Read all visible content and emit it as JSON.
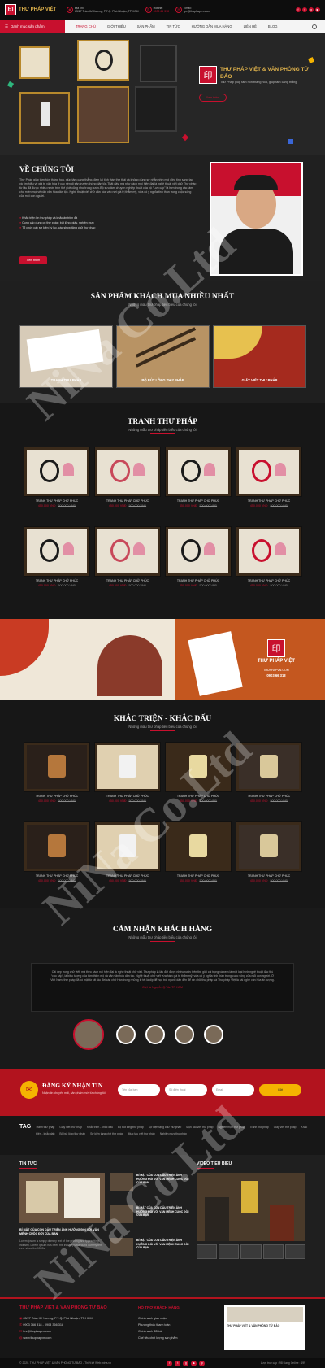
{
  "header": {
    "brand": "THƯ PHÁP VIỆT",
    "address_label": "Địa chỉ:",
    "address": "65/27 Trần Kế Xương, P.7.Q. Phú Nhuận, TP.HCM",
    "hotline_label": "Hotline:",
    "hotline": "0903 66 318",
    "email_label": "Email:",
    "email": "tpv@thuphapvn.com"
  },
  "nav": {
    "category_label": "Danh mục sản phẩm",
    "items": [
      "TRANG CHỦ",
      "GIỚI THIỆU",
      "SẢN PHẨM",
      "TIN TỨC",
      "HƯỚNG DẪN MUA HÀNG",
      "LIÊN HỆ",
      "BLOG"
    ]
  },
  "hero": {
    "title": "THƯ PHÁP VIỆT & VĂN PHÒNG TỨ BẢO",
    "subtitle": "Thư Pháp giúp tâm hồn thăng hoa, giúp tâm càng thẳng",
    "button": "Xem thêm"
  },
  "about": {
    "title": "VỀ CHÚNG TÔI",
    "desc": "Thư Pháp giúp tâm hồn thăng hoa, giúp tâm càng thẳng, đem lại tinh thần thư thái và không dùng sự nhẫn nhịn mọi điều tinh sáng tạo và tìm hiểu về giá trị văn hóa ở các nền di sản truyền thống dân tộc.Thật đấy, mà như cách mọi hiện đại là nghệ thuật viết chữ Thư pháp từ lâu đã được nhiều nước trên thế giới cũng như trong nước.Bộ sưu tầm chuyên nghiệp thuật của bộ “Lưu cấp” là hơn trong các làm cho miền mọi vẻ văn văn hóa dân tộc. Nghệ thuật viết chữ văn hóa vào nơi giá trị thẩm mỹ, vừa có ý nghĩa tinh thần trong cuộc sống của mỗi con người.",
    "bullets": [
      "Khắc triện bn thư pháp và khắc ấn triện đá",
      "Cung cấp dụng cụ thư pháp: bút lông, giấy, nghiên mực",
      "Tổ chức các sự kiện kỷ lục, các show tặng chữ thư pháp"
    ],
    "button": "Xem thêm"
  },
  "bestsellers": {
    "title": "SẢN PHẨM KHÁCH MUA NHIỀU NHẤT",
    "subtitle": "Những mẫu thư pháp tiêu biểu của chúng tôi",
    "items": [
      "TRANH THƯ PHÁP",
      "BỘ BÚT LÔNG THƯ PHÁP",
      "GIẤY VIẾT THƯ PHÁP"
    ]
  },
  "tranh": {
    "title": "TRANH THƯ PHÁP",
    "subtitle": "Những mẫu thư pháp tiêu biểu của chúng tôi",
    "products": [
      {
        "name": "TRANH THƯ PHÁP CHỮ PHÚC",
        "price": "450.000 VNĐ",
        "old": "500.000 VNĐ"
      },
      {
        "name": "TRANH THƯ PHÁP CHỮ PHÚC",
        "price": "450.000 VNĐ",
        "old": "500.000 VNĐ"
      },
      {
        "name": "TRANH THƯ PHÁP CHỮ PHÚC",
        "price": "450.000 VNĐ",
        "old": "500.000 VNĐ"
      },
      {
        "name": "TRANH THƯ PHÁP CHỮ PHÚC",
        "price": "450.000 VNĐ",
        "old": "500.000 VNĐ"
      },
      {
        "name": "TRANH THƯ PHÁP CHỮ PHÚC",
        "price": "450.000 VNĐ",
        "old": "500.000 VNĐ"
      },
      {
        "name": "TRANH THƯ PHÁP CHỮ PHÚC",
        "price": "450.000 VNĐ",
        "old": "500.000 VNĐ"
      },
      {
        "name": "TRANH THƯ PHÁP CHỮ PHÚC",
        "price": "450.000 VNĐ",
        "old": "500.000 VNĐ"
      },
      {
        "name": "TRANH THƯ PHÁP CHỮ PHÚC",
        "price": "450.000 VNĐ",
        "old": "500.000 VNĐ"
      }
    ]
  },
  "banner": {
    "brand": "THƯ PHÁP VIỆT",
    "site": "THUPHAPVN.COM",
    "phone": "0903 66 318"
  },
  "khac": {
    "title": "KHẮC TRIỆN - KHẮC DẤU",
    "subtitle": "Những mẫu thư pháp tiêu biểu của chúng tôi",
    "products": [
      {
        "name": "TRANH THƯ PHÁP CHỮ PHÚC",
        "price": "450.000 VNĐ",
        "old": "500.000 VNĐ"
      },
      {
        "name": "TRANH THƯ PHÁP CHỮ PHÚC",
        "price": "450.000 VNĐ",
        "old": "500.000 VNĐ"
      },
      {
        "name": "TRANH THƯ PHÁP CHỮ PHÚC",
        "price": "450.000 VNĐ",
        "old": "500.000 VNĐ"
      },
      {
        "name": "TRANH THƯ PHÁP CHỮ PHÚC",
        "price": "450.000 VNĐ",
        "old": "500.000 VNĐ"
      },
      {
        "name": "TRANH THƯ PHÁP CHỮ PHÚC",
        "price": "450.000 VNĐ",
        "old": "500.000 VNĐ"
      },
      {
        "name": "TRANH THƯ PHÁP CHỮ PHÚC",
        "price": "450.000 VNĐ",
        "old": "500.000 VNĐ"
      },
      {
        "name": "TRANH THƯ PHÁP CHỮ PHÚC",
        "price": "450.000 VNĐ",
        "old": "500.000 VNĐ"
      },
      {
        "name": "TRANH THƯ PHÁP CHỮ PHÚC",
        "price": "450.000 VNĐ",
        "old": "500.000 VNĐ"
      }
    ]
  },
  "reviews": {
    "title": "CẢM NHẬN KHÁCH HÀNG",
    "subtitle": "Những mẫu thư pháp tiêu biểu của chúng tôi",
    "text": "Cái đẹp trong chữ viết, mà theo cách nói hiện đại là nghệ thuật chữ viết. Thư pháp là lâu đời được nhiều nước trên thế giới coi trọng và xem là một loại hình nghệ thuật đặc thù “cao cấp”, là biểu tượng của tâm thiền mộ và văn văn hóa dân tộc. Nghệ thuật chữ viết vừa hàm giá trị thẩm mỹ, vừa có ý nghĩa tinh thần trong cuộc sống của mỗi con người. Ở Việt Nam, thư pháp đã có mặt từ rất lâu đời các chữ Hán trong những lễ tết là dịp để học trò, người dân đến để xin chữ thư pháp và Thư pháp Việt là cái nghề văn hóa ấn tượng.",
    "author": "Chị Hà Nguyễn Q.Tân TP HCM"
  },
  "newsletter": {
    "title": "ĐĂNG KÝ NHẬN TIN",
    "subtitle": "Nhận tin khuyến mãi, sản phẩm mới từ chúng tôi",
    "name_ph": "Tên của bạn",
    "phone_ph": "Số điện thoại",
    "email_ph": "Email",
    "button": "Gửi"
  },
  "tags": {
    "title": "TAG",
    "items": [
      "Tranh thư pháp",
      "Giấy viết thư pháp",
      "Khắc triện - khắc dấu",
      "Bộ bút lông thư pháp",
      "Sự kiện tặng chữ thư pháp",
      "Mực tàu viết thư pháp",
      "Nghiên mực thư pháp",
      "Tranh thư pháp",
      "Giấy viết thư pháp",
      "Khắc triện - khắc dấu",
      "Bộ bút lông thư pháp",
      "Sự kiện tặng chữ thư pháp",
      "Mực tàu viết thư pháp",
      "Nghiên mực thư pháp"
    ]
  },
  "news": {
    "title": "TIN TỨC",
    "main_title": "BÍ MẬT CỦA CON DẤU TRIỆN ẢNH HƯỞNG ĐỐI VỚI VẬN MỆNH CUỘC ĐỜI CỦA BẠN",
    "main_desc": "Lorem Ipsum is simply dummy text of the printing and typesetting industry. Lorem Ipsum has been the industry's standard dummy text ever since the 1500s.",
    "items": [
      "BÍ MẬT CỦA CON DẤU TRIỆN ẢNH HƯỞNG ĐỐI VỚI VẬN MỆNH CUỘC ĐỜI CỦA BẠN",
      "BÍ MẬT CỦA CON DẤU TRIỆN ẢNH HƯỞNG ĐỐI VỚI VẬN MỆNH CUỘC ĐỜI CỦA BẠN",
      "BÍ MẬT CỦA CON DẤU TRIỆN ẢNH HƯỞNG ĐỐI VỚI VẬN MỆNH CUỘC ĐỜI CỦA BẠN"
    ],
    "video_title": "VIDEO TIÊU BIỂU"
  },
  "footer": {
    "title": "THƯ PHÁP VIỆT & VĂN PHÒNG TỨ BẢO",
    "address": "65/27 Trần Kế Xương, P.7.Q. Phú Nhuận, TP.HCM",
    "phone": "0903 366 318 - 0903 366 318",
    "email": "tpv@thuphapvn.com",
    "web": "www.thuphapvn.com",
    "support_title": "HỖ TRỢ KHÁCH HÀNG",
    "support": [
      "Chính sách giao nhận",
      "Phương thức thanh toán",
      "Chính sách đổi trả",
      "Chế tiêu chết lượng sản phẩm"
    ],
    "fb_name": "THƯ PHÁP VIỆT & VĂN PHÒNG TỨ BẢO",
    "copyright": "© 2020. THƯ PHÁP VIỆT & VĂN PHÒNG TỨ BẢO - Thiết kế Web: nina.vn",
    "stats": "Lượt truy cập : 98   Đang Online : 199"
  },
  "watermark": "NiNa Co.Ltd",
  "colors": {
    "accent": "#c8102e",
    "gold": "#e0b34c",
    "dark": "#171717"
  }
}
